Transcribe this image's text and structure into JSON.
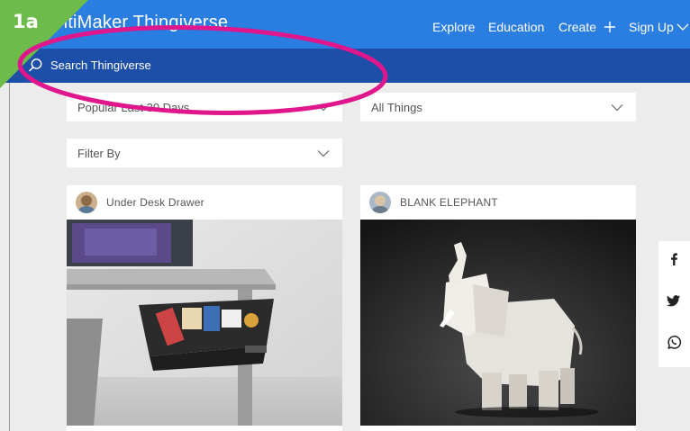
{
  "header": {
    "logo_text": "UltiMaker Thingiverse",
    "nav": {
      "explore": "Explore",
      "education": "Education",
      "create": "Create",
      "signup": "Sign Up"
    }
  },
  "search": {
    "placeholder": "Search Thingiverse"
  },
  "annotation": {
    "label": "1a"
  },
  "filters": {
    "sort": "Popular Last 30 Days",
    "type": "All Things",
    "filter_by": "Filter By"
  },
  "cards": [
    {
      "title": "Under Desk Drawer"
    },
    {
      "title": "BLANK ELEPHANT"
    }
  ],
  "share": {
    "icons": [
      "facebook-icon",
      "twitter-icon",
      "whatsapp-icon"
    ]
  },
  "colors": {
    "header_blue": "#2a7de1",
    "search_blue": "#1d4fa9",
    "badge_green": "#6dbb4b",
    "annotation_magenta": "#e0168c"
  }
}
